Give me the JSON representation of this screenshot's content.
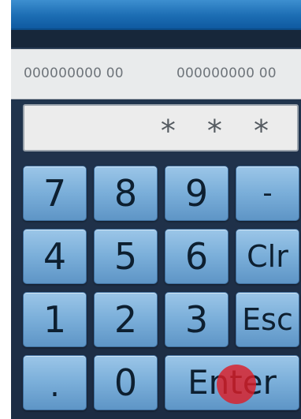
{
  "info_bar": {
    "left_value": "000000000 00",
    "right_value": "000000000 00"
  },
  "pin_display": {
    "masked_value": "* * *"
  },
  "keypad": {
    "rows": [
      [
        "7",
        "8",
        "9",
        "-"
      ],
      [
        "4",
        "5",
        "6",
        "Clr"
      ],
      [
        "1",
        "2",
        "3",
        "Esc"
      ],
      [
        ".",
        "0",
        "Enter"
      ]
    ],
    "key_7": "7",
    "key_8": "8",
    "key_9": "9",
    "key_minus": "-",
    "key_4": "4",
    "key_5": "5",
    "key_6": "6",
    "key_clr": "Clr",
    "key_1": "1",
    "key_2": "2",
    "key_3": "3",
    "key_esc": "Esc",
    "key_dot": ".",
    "key_0": "0",
    "key_enter": "Enter"
  },
  "colors": {
    "title_bar": "#1c6db3",
    "background": "#1d2f45",
    "key_top": "#9cc6e8",
    "key_bottom": "#5e95c6",
    "tap_indicator": "#dc1e28"
  }
}
